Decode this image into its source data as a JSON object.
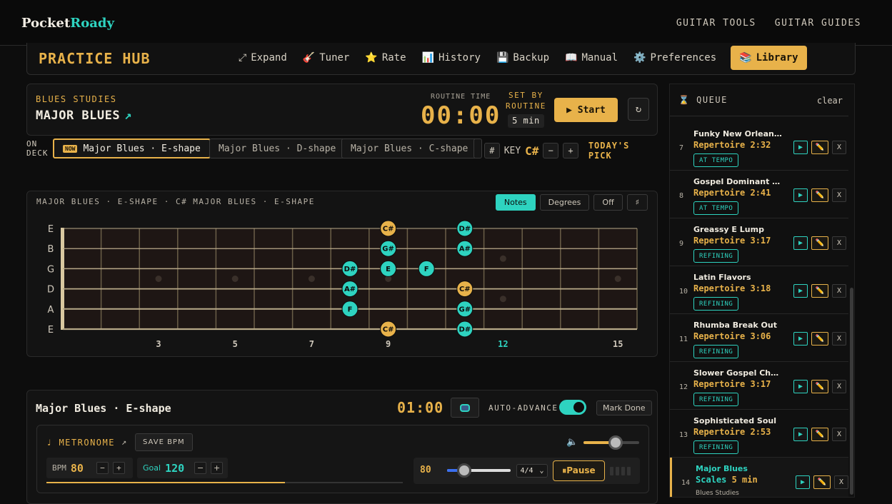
{
  "brand": {
    "name": "Pocket",
    "accent": "Roady"
  },
  "topnav": [
    "GUITAR TOOLS",
    "GUITAR GUIDES"
  ],
  "hub": {
    "title": "PRACTICE HUB",
    "menu": [
      {
        "icon": "⤢",
        "label": "Expand"
      },
      {
        "icon": "🎸",
        "label": "Tuner"
      },
      {
        "icon": "⭐",
        "label": "Rate"
      },
      {
        "icon": "📊",
        "label": "History"
      },
      {
        "icon": "💾",
        "label": "Backup"
      },
      {
        "icon": "📖",
        "label": "Manual"
      },
      {
        "icon": "⚙️",
        "label": "Preferences"
      },
      {
        "icon": "📚",
        "label": "Library"
      }
    ]
  },
  "routine": {
    "category": "BLUES STUDIES",
    "name": "MAJOR BLUES",
    "time_label": "ROUTINE TIME",
    "time": "00:00",
    "set_by": "SET BY",
    "set_by2": "ROUTINE",
    "duration": "5 min",
    "start": "▶ Start",
    "reset_icon": "↻"
  },
  "ondeck": {
    "label1": "ON",
    "label2": "DECK",
    "now_tag": "NOW",
    "items": [
      "Major Blues · E-shape",
      "Major Blues · D-shape",
      "Major Blues · C-shape"
    ],
    "sharp": "#",
    "key_label": "KEY",
    "key": "C#",
    "minus": "−",
    "plus": "+",
    "pick": "TODAY'S PICK"
  },
  "fretboard": {
    "title": "MAJOR BLUES · E-SHAPE · C# MAJOR BLUES · E-SHAPE",
    "toggles": [
      "Notes",
      "Degrees",
      "Off",
      "♯"
    ],
    "strings": [
      "E",
      "B",
      "G",
      "D",
      "A",
      "E"
    ],
    "fret_numbers": [
      {
        "fret": 3,
        "label": "3"
      },
      {
        "fret": 5,
        "label": "5"
      },
      {
        "fret": 7,
        "label": "7"
      },
      {
        "fret": 9,
        "label": "9"
      },
      {
        "fret": 12,
        "label": "12"
      },
      {
        "fret": 15,
        "label": "15"
      }
    ],
    "notes": [
      {
        "string": 0,
        "fret": 9,
        "label": "C#",
        "root": true
      },
      {
        "string": 0,
        "fret": 11,
        "label": "D#",
        "root": false
      },
      {
        "string": 1,
        "fret": 9,
        "label": "G#",
        "root": false
      },
      {
        "string": 1,
        "fret": 11,
        "label": "A#",
        "root": false
      },
      {
        "string": 2,
        "fret": 8,
        "label": "D#",
        "root": false
      },
      {
        "string": 2,
        "fret": 9,
        "label": "E",
        "root": false
      },
      {
        "string": 2,
        "fret": 10,
        "label": "F",
        "root": false
      },
      {
        "string": 3,
        "fret": 8,
        "label": "A#",
        "root": false
      },
      {
        "string": 3,
        "fret": 11,
        "label": "C#",
        "root": true
      },
      {
        "string": 4,
        "fret": 8,
        "label": "F",
        "root": false
      },
      {
        "string": 4,
        "fret": 11,
        "label": "G#",
        "root": false
      },
      {
        "string": 5,
        "fret": 9,
        "label": "C#",
        "root": true
      },
      {
        "string": 5,
        "fret": 11,
        "label": "D#",
        "root": false
      }
    ]
  },
  "practice": {
    "title": "Major Blues · E-shape",
    "time": "01:00",
    "auto_advance": "AUTO-ADVANCE",
    "mark_done": "Mark Done",
    "metronome": "♩ METRONOME",
    "ext": "↗",
    "save_bpm": "SAVE BPM",
    "volume_icon": "🔈",
    "volume": 0.58,
    "bpm_label": "BPM",
    "bpm": "80",
    "goal_label": "Goal",
    "goal": "120",
    "progress": 0.67,
    "player_bpm": "80",
    "tempo_level": 0.27,
    "time_sig": "4/4",
    "caret": "⌄",
    "pause": "⏸Pause"
  },
  "queue": {
    "title": "⌛ QUEUE",
    "clear": "clear",
    "items": [
      {
        "num": "7",
        "title": "Funky New Orleans...",
        "type": "Repertoire",
        "time": "2:32",
        "tag": "AT TEMPO"
      },
      {
        "num": "8",
        "title": "Gospel Dominant F...",
        "type": "Repertoire",
        "time": "2:41",
        "tag": "AT TEMPO"
      },
      {
        "num": "9",
        "title": "Greassy E Lump",
        "type": "Repertoire",
        "time": "3:17",
        "tag": "REFINING"
      },
      {
        "num": "10",
        "title": "Latin Flavors",
        "type": "Repertoire",
        "time": "3:18",
        "tag": "REFINING"
      },
      {
        "num": "11",
        "title": "Rhumba Break Out",
        "type": "Repertoire",
        "time": "3:06",
        "tag": "REFINING"
      },
      {
        "num": "12",
        "title": "Slower Gospel Cha...",
        "type": "Repertoire",
        "time": "3:17",
        "tag": "REFINING"
      },
      {
        "num": "13",
        "title": "Sophisticated Soul",
        "type": "Repertoire",
        "time": "2:53",
        "tag": "REFINING"
      }
    ],
    "current": {
      "num": "14",
      "title": "Major Blues",
      "type": "Scales",
      "time": "5 min",
      "note": "Blues Studies"
    },
    "btn_play": "▶",
    "btn_edit": "✏️",
    "btn_remove": "X"
  }
}
